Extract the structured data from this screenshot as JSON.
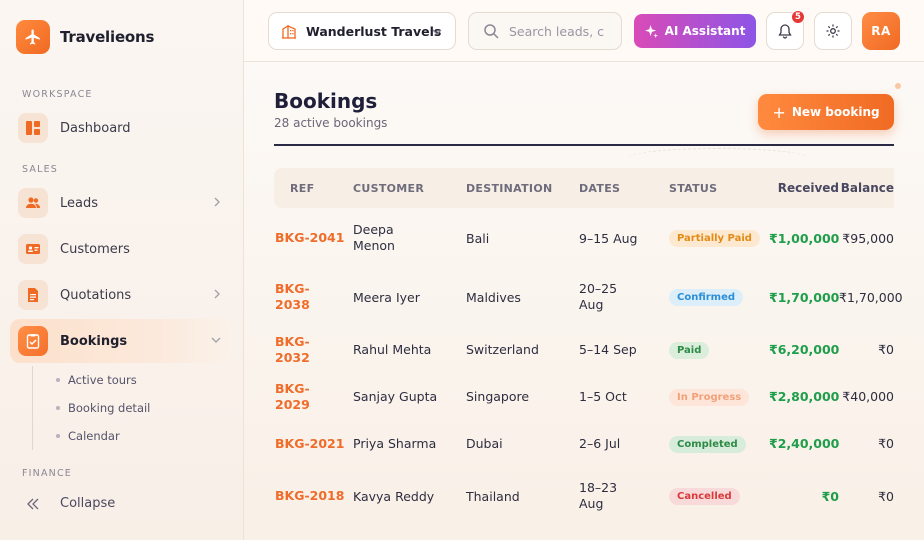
{
  "app": {
    "name": "Travelieons"
  },
  "sidebar": {
    "sections": {
      "workspace": "WORKSPACE",
      "sales": "SALES",
      "finance": "FINANCE"
    },
    "items": [
      {
        "label": "Dashboard",
        "icon": "dashboard-icon"
      },
      {
        "label": "Leads",
        "icon": "users-icon"
      },
      {
        "label": "Customers",
        "icon": "id-card-icon"
      },
      {
        "label": "Quotations",
        "icon": "document-icon"
      },
      {
        "label": "Bookings",
        "icon": "clipboard-check-icon",
        "active": true
      }
    ],
    "bookings_sub": [
      "Active tours",
      "Booking detail",
      "Calendar"
    ],
    "collapse_label": "Collapse"
  },
  "topbar": {
    "org_name": "Wanderlust Travels",
    "search_placeholder": "Search leads, c",
    "ai_label": "AI Assistant",
    "notification_count": "5",
    "avatar_initials": "RA"
  },
  "page": {
    "title": "Bookings",
    "subtitle": "28 active bookings",
    "new_button": "New booking"
  },
  "table": {
    "headers": [
      "REF",
      "CUSTOMER",
      "DESTINATION",
      "DATES",
      "STATUS",
      "Received",
      "Balance"
    ],
    "rows": [
      {
        "ref": "BKG-2041",
        "customer": "Deepa Menon",
        "destination": "Bali",
        "dates": "9–15 Aug",
        "status": "Partially Paid",
        "received": "₹1,00,000",
        "balance": "₹95,000"
      },
      {
        "ref": "BKG-2038",
        "customer": "Meera Iyer",
        "destination": "Maldives",
        "dates": "20–25 Aug",
        "status": "Confirmed",
        "received": "₹1,70,000",
        "balance": "₹1,70,000"
      },
      {
        "ref": "BKG-2032",
        "customer": "Rahul Mehta",
        "destination": "Switzerland",
        "dates": "5–14 Sep",
        "status": "Paid",
        "received": "₹6,20,000",
        "balance": "₹0"
      },
      {
        "ref": "BKG-2029",
        "customer": "Sanjay Gupta",
        "destination": "Singapore",
        "dates": "1–5 Oct",
        "status": "In Progress",
        "received": "₹2,80,000",
        "balance": "₹40,000"
      },
      {
        "ref": "BKG-2021",
        "customer": "Priya Sharma",
        "destination": "Dubai",
        "dates": "2–6 Jul",
        "status": "Completed",
        "received": "₹2,40,000",
        "balance": "₹0"
      },
      {
        "ref": "BKG-2018",
        "customer": "Kavya Reddy",
        "destination": "Thailand",
        "dates": "18–23 Aug",
        "status": "Cancelled",
        "received": "₹0",
        "balance": "₹0"
      }
    ]
  },
  "colors": {
    "accent": "#F06A23",
    "positive": "#1E9E4A",
    "ai_gradient_start": "#D94BB7",
    "ai_gradient_end": "#8D55E6"
  }
}
